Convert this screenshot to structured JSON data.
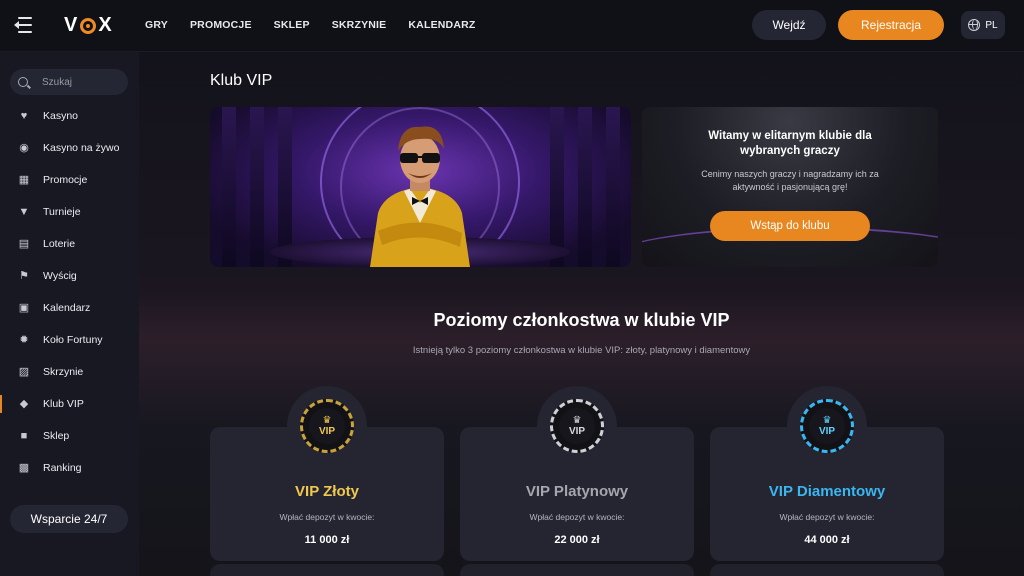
{
  "topbar": {
    "logo": "VOX",
    "nav": [
      "GRY",
      "PROMOCJE",
      "SKLEP",
      "SKRZYNIE",
      "KALENDARZ"
    ],
    "login_label": "Wejdź",
    "register_label": "Rejestracja",
    "lang": "PL",
    "accent_color": "#e8861f"
  },
  "sidebar": {
    "search_placeholder": "Szukaj",
    "items": [
      {
        "label": "Kasyno",
        "icon": "cherries-icon"
      },
      {
        "label": "Kasyno na żywo",
        "icon": "live-icon"
      },
      {
        "label": "Promocje",
        "icon": "gift-icon"
      },
      {
        "label": "Turnieje",
        "icon": "trophy-icon"
      },
      {
        "label": "Loterie",
        "icon": "lottery-icon"
      },
      {
        "label": "Wyścig",
        "icon": "race-flag-icon"
      },
      {
        "label": "Kalendarz",
        "icon": "calendar-icon"
      },
      {
        "label": "Koło Fortuny",
        "icon": "wheel-icon"
      },
      {
        "label": "Skrzynie",
        "icon": "chest-icon"
      },
      {
        "label": "Klub VIP",
        "icon": "diamond-icon",
        "active": true
      },
      {
        "label": "Sklep",
        "icon": "bag-icon"
      },
      {
        "label": "Ranking",
        "icon": "ranking-icon"
      }
    ],
    "support_label": "Wsparcie 24/7"
  },
  "main": {
    "title": "Klub VIP",
    "welcome": {
      "heading": "Witamy w elitarnym klubie dla wybranych graczy",
      "text": "Cenimy naszych graczy i nagradzamy ich za aktywność i pasjonującą grę!",
      "button": "Wstąp do klubu"
    },
    "levels_title": "Poziomy członkostwa w klubie VIP",
    "levels_subtitle": "Istnieją tylko 3 poziomy członkostwa w klubie VIP: złoty, platynowy i diamentowy",
    "levels": [
      {
        "name": "VIP Złoty",
        "deposit_label": "Wpłać depozyt w kwocie:",
        "amount": "11 000 zł",
        "chip_text": "VIP",
        "color": "#f0c850"
      },
      {
        "name": "VIP Platynowy",
        "deposit_label": "Wpłać depozyt w kwocie:",
        "amount": "22 000 zł",
        "chip_text": "VIP",
        "color": "#a6a6ae"
      },
      {
        "name": "VIP Diamentowy",
        "deposit_label": "Wpłać depozyt w kwocie:",
        "amount": "44 000 zł",
        "chip_text": "VIP",
        "color": "#3ab6f0"
      }
    ]
  }
}
